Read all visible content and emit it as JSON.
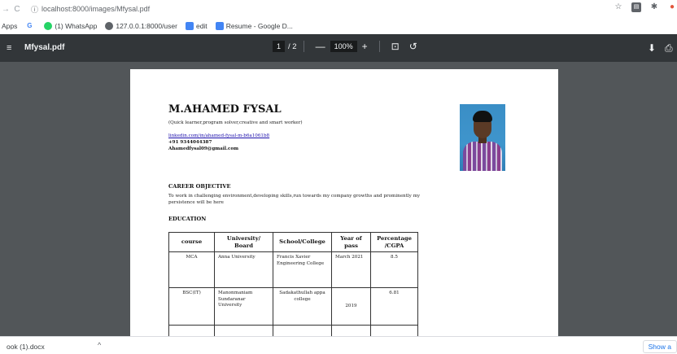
{
  "browser": {
    "nav_back": "→",
    "nav_reload": "C",
    "url_icon": "ⓘ",
    "url": "localhost:8000/images/Mfysal.pdf",
    "right_icons": [
      "star-icon",
      "extensions-icon",
      "puzzle-icon",
      "profile-icon"
    ]
  },
  "bookmarks": [
    {
      "label": "Apps",
      "icon": ""
    },
    {
      "label": "",
      "icon": "G"
    },
    {
      "label": "(1) WhatsApp",
      "icon": "wa"
    },
    {
      "label": "127.0.0.1:8000/user",
      "icon": "globe"
    },
    {
      "label": "edit",
      "icon": "doc"
    },
    {
      "label": "Resume - Google D...",
      "icon": "doc"
    }
  ],
  "pdf_toolbar": {
    "menu_glyph": "≡",
    "filename": "Mfysal.pdf",
    "page_current": "1",
    "page_total": "/ 2",
    "zoom_out": "—",
    "zoom": "100%",
    "zoom_in": "+",
    "fit_glyph": "⊡",
    "rotate_glyph": "↺",
    "download_glyph": "⬇",
    "print_glyph": "⎙"
  },
  "resume": {
    "name": "M.AHAMED FYSAL",
    "tagline": "(Quick learner,program solver,creative and smart worker)",
    "linkedin": "linkedin.com/in/ahamed-fysal-m-b6a1061b8",
    "phone": "+91 9344044387",
    "email": "Ahamedfysal09@gmail.com",
    "career_heading": "CAREER OBJECTIVE",
    "career_text": "To work in challenging environment,developing skills,run towards my company growths and prominently my persistence will be here",
    "education_heading": "EDUCATION",
    "table_headers": [
      "course",
      "University/ Board",
      "School/College",
      "Year of pass",
      "Percentage /CGPA"
    ],
    "rows": [
      [
        "MCA",
        "Anna University",
        "Francis Xavier Engineering College",
        "March 2021",
        "8.5"
      ],
      [
        "BSC(IT)",
        "Manonmaniam Sundaranar University",
        "Sadakathullah appa college",
        "2019",
        "6.81"
      ]
    ]
  },
  "downloads": {
    "file": "ook (1).docx",
    "chevron": "^",
    "show_all": "Show a"
  }
}
